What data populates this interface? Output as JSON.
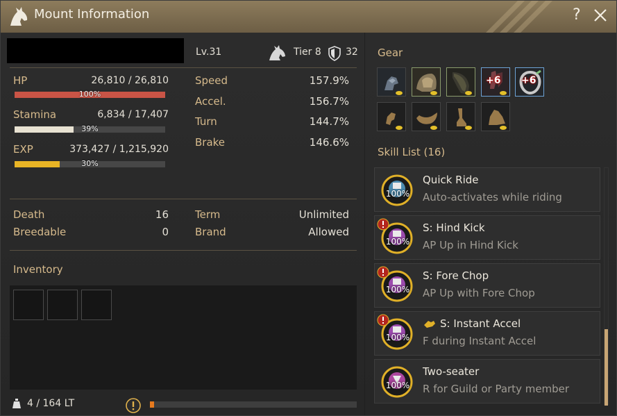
{
  "window": {
    "title": "Mount Information",
    "help_label": "?"
  },
  "header": {
    "level": "Lv.31",
    "tier": "Tier 8",
    "tier_value": "32"
  },
  "stats": {
    "hp": {
      "label": "HP",
      "value": "26,810 / 26,810",
      "percent_label": "100%",
      "fill": 100,
      "color": "#c95446"
    },
    "stamina": {
      "label": "Stamina",
      "value": "6,834 / 17,407",
      "percent_label": "39%",
      "fill": 39,
      "color": "#e8e2d2"
    },
    "exp": {
      "label": "EXP",
      "value": "373,427 / 1,215,920",
      "percent_label": "30%",
      "fill": 30,
      "color": "#e8b425"
    }
  },
  "movement": [
    {
      "label": "Speed",
      "value": "157.9%"
    },
    {
      "label": "Accel.",
      "value": "156.7%"
    },
    {
      "label": "Turn",
      "value": "144.7%"
    },
    {
      "label": "Brake",
      "value": "146.6%"
    }
  ],
  "info": {
    "death_label": "Death",
    "death_value": "16",
    "breedable_label": "Breedable",
    "breedable_value": "0",
    "term_label": "Term",
    "term_value": "Unlimited",
    "brand_label": "Brand",
    "brand_value": "Allowed"
  },
  "inventory": {
    "title": "Inventory",
    "weight": "4 / 164 LT",
    "weight_fill": 2,
    "weight_color": "#e77a1e"
  },
  "gear": {
    "title": "Gear",
    "row1": [
      {
        "icon": "horse-head-armor-icon"
      },
      {
        "icon": "saddle-icon"
      },
      {
        "icon": "barding-icon"
      },
      {
        "icon": "stirrups-icon",
        "enhance": "+6"
      },
      {
        "icon": "horseshoe-icon",
        "enhance": "+6"
      }
    ],
    "row2": [
      {
        "icon": "empty-champron-slot-icon"
      },
      {
        "icon": "empty-saddle-slot-icon"
      },
      {
        "icon": "empty-barding-slot-icon"
      },
      {
        "icon": "empty-horseshoe-slot-icon"
      }
    ]
  },
  "skills": {
    "title": "Skill List (16)",
    "items": [
      {
        "name": "Quick Ride",
        "desc": "Auto-activates while riding",
        "percent": "100%",
        "alert": false,
        "color": "#5aa9d6"
      },
      {
        "name": "S: Hind Kick",
        "desc": "AP Up in Hind Kick",
        "percent": "100%",
        "alert": true,
        "color": "#b455c9"
      },
      {
        "name": "S: Fore Chop",
        "desc": "AP Up with Fore Chop",
        "percent": "100%",
        "alert": true,
        "color": "#b455c9"
      },
      {
        "name": "S: Instant Accel",
        "desc": "F during Instant Accel",
        "percent": "100%",
        "alert": true,
        "color": "#b455c9"
      },
      {
        "name": "Two-seater",
        "desc": "R for Guild or Party member",
        "percent": "100%",
        "alert": false,
        "color": "#c64fb6"
      }
    ]
  }
}
